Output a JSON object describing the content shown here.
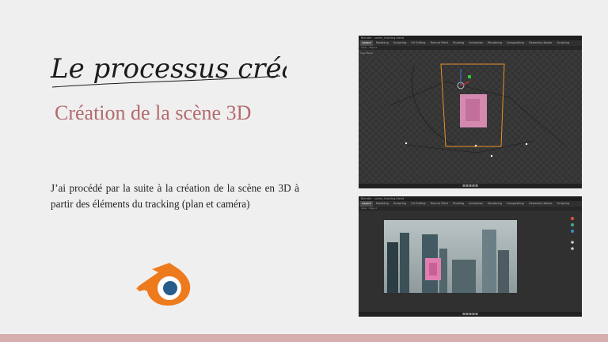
{
  "title_script": "Le processus créatif",
  "subtitle": "Création de la scène 3D",
  "body": "J’ai procédé par la suite à la création de la scène en 3D à partir des éléments du tracking (plan et caméra)",
  "logo": {
    "icon": "blender-logo",
    "color_orange": "#ee7a1e",
    "color_blue": "#265d8a"
  },
  "colors": {
    "accent": "#b36a6e",
    "band": "#d6aeb0",
    "background": "#f0efef"
  },
  "screenshot1": {
    "window_title": "Blender - scene_tracking.blend",
    "tabs": [
      "Layout",
      "Modeling",
      "Sculpting",
      "UV Editing",
      "Texture Paint",
      "Shading",
      "Animation",
      "Rendering",
      "Compositing",
      "Geometry Nodes",
      "Scripting"
    ],
    "header": [
      "View",
      "Object"
    ],
    "viewport_label": "User Persp"
  },
  "screenshot2": {
    "window_title": "Blender - scene_tracking.blend",
    "tabs": [
      "Layout",
      "Modeling",
      "Sculpting",
      "UV Editing",
      "Texture Paint",
      "Shading",
      "Animation",
      "Rendering",
      "Compositing",
      "Geometry Nodes",
      "Scripting"
    ],
    "header": [
      "View",
      "Object"
    ]
  }
}
